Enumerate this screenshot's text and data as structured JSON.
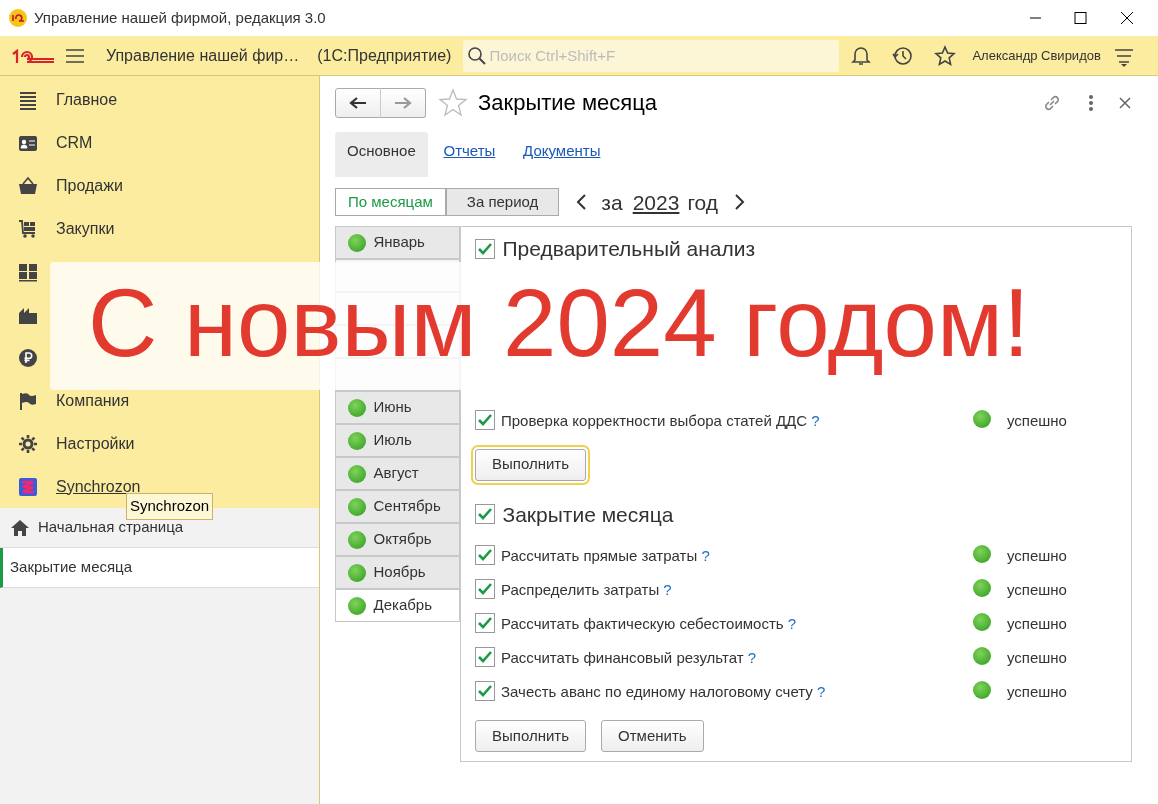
{
  "window": {
    "title": "Управление нашей фирмой, редакция 3.0"
  },
  "toolbar": {
    "app_name": "Управление нашей фир…",
    "platform": "(1С:Предприятие)",
    "search": {
      "placeholder": "Поиск Ctrl+Shift+F"
    },
    "user": "Александр Свиридов"
  },
  "sidebar": {
    "items": [
      {
        "label": "Главное",
        "kind": "plain"
      },
      {
        "label": "CRM",
        "kind": "plain"
      },
      {
        "label": "Продажи",
        "kind": "plain"
      },
      {
        "label": "Закупки",
        "kind": "plain"
      },
      {
        "kind": "covered"
      },
      {
        "kind": "covered"
      },
      {
        "kind": "covered"
      },
      {
        "label": "Компания",
        "kind": "plain"
      },
      {
        "label": "Настройки",
        "kind": "plain"
      },
      {
        "label": "Synchrozon",
        "kind": "link"
      }
    ],
    "open_windows": [
      {
        "label": "Начальная страница",
        "selected": false
      },
      {
        "label": "Закрытие месяца",
        "selected": true
      }
    ],
    "tooltip": "Synchrozon"
  },
  "form": {
    "title": "Закрытие месяца",
    "tabs": [
      {
        "label": "Основное",
        "selected": true
      },
      {
        "label": "Отчеты",
        "selected": false
      },
      {
        "label": "Документы",
        "selected": false
      }
    ],
    "period_modes": [
      {
        "label": "По месяцам",
        "selected": true
      },
      {
        "label": "За период",
        "selected": false
      }
    ],
    "year_nav": {
      "prefix": "за",
      "year": "2023",
      "suffix": "год"
    },
    "months": [
      {
        "label": "Январь",
        "kind": "tab",
        "selected": false
      },
      {
        "kind": "covered"
      },
      {
        "kind": "covered"
      },
      {
        "kind": "covered"
      },
      {
        "kind": "covered"
      },
      {
        "label": "Июнь",
        "kind": "tab",
        "selected": false
      },
      {
        "label": "Июль",
        "kind": "tab",
        "selected": false
      },
      {
        "label": "Август",
        "kind": "tab",
        "selected": false
      },
      {
        "label": "Сентябрь",
        "kind": "tab",
        "selected": false
      },
      {
        "label": "Октябрь",
        "kind": "tab",
        "selected": false
      },
      {
        "label": "Ноябрь",
        "kind": "tab",
        "selected": false
      },
      {
        "label": "Декабрь",
        "kind": "tab",
        "selected": true
      }
    ],
    "sections": [
      {
        "title": "Предварительный анализ",
        "checked": true,
        "rows": [
          {
            "kind": "covered"
          },
          {
            "kind": "covered"
          },
          {
            "kind": "covered"
          },
          {
            "kind": "task",
            "label": "Проверка корректности выбора статей ДДС",
            "help": "?",
            "checked": true,
            "status": "успешно"
          }
        ],
        "buttons": [
          {
            "label": "Выполнить",
            "focused": true
          }
        ]
      },
      {
        "title": "Закрытие месяца",
        "checked": true,
        "rows": [
          {
            "kind": "task",
            "label": "Рассчитать прямые затраты",
            "help": "?",
            "checked": true,
            "status": "успешно"
          },
          {
            "kind": "task",
            "label": "Распределить затраты",
            "help": "?",
            "checked": true,
            "status": "успешно"
          },
          {
            "kind": "task",
            "label": "Рассчитать фактическую себестоимость",
            "help": "?",
            "checked": true,
            "status": "успешно"
          },
          {
            "kind": "task",
            "label": "Рассчитать финансовый результат",
            "help": "?",
            "checked": true,
            "status": "успешно"
          },
          {
            "kind": "task",
            "label": "Зачесть аванс по единому налоговому счету",
            "help": "?",
            "checked": true,
            "status": "успешно"
          }
        ],
        "buttons": [
          {
            "label": "Выполнить",
            "focused": false
          },
          {
            "label": "Отменить",
            "focused": false
          }
        ]
      }
    ]
  },
  "banner": {
    "text": "С новым 2024 годом!"
  }
}
